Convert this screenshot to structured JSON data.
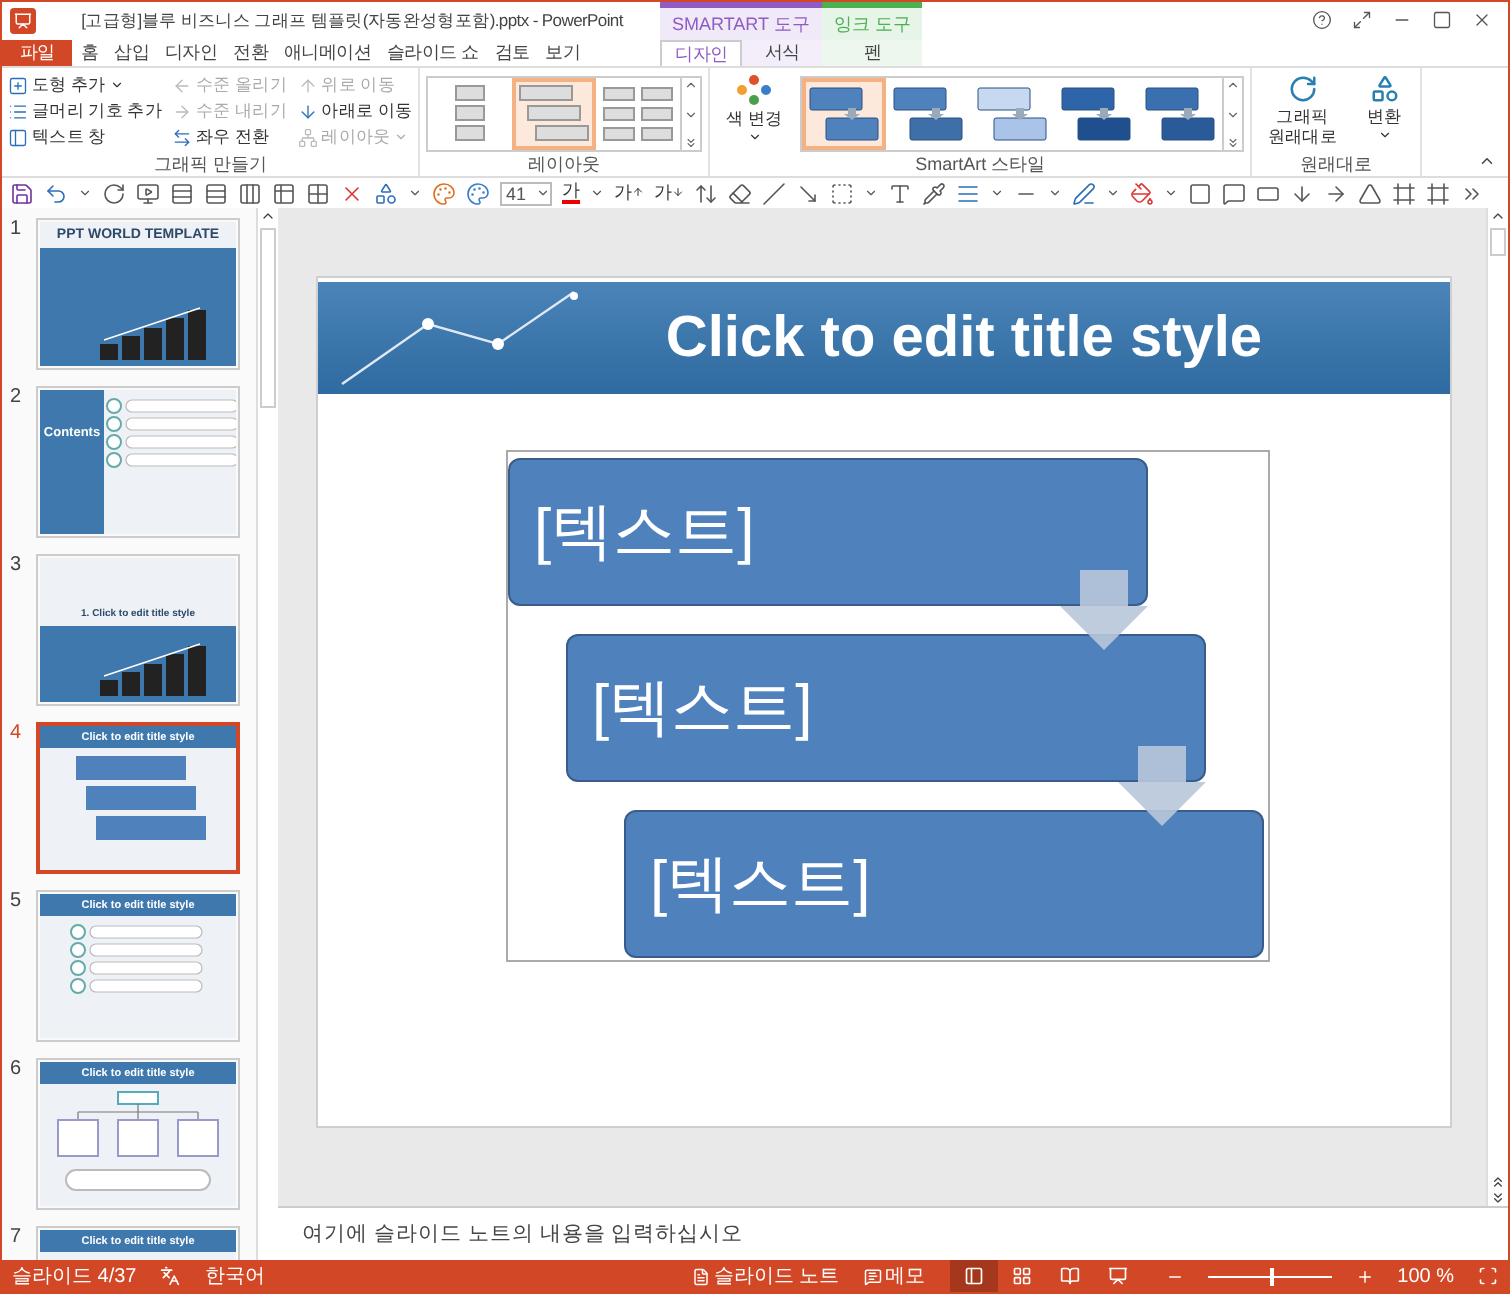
{
  "window": {
    "title": "[고급형]블루 비즈니스 그래프 템플릿(자동완성형포함).pptx - PowerPoint"
  },
  "tabs": [
    {
      "label": "파일",
      "kind": "file",
      "selected": false
    },
    {
      "label": "홈",
      "kind": "main",
      "selected": false
    },
    {
      "label": "삽입",
      "kind": "main",
      "selected": false
    },
    {
      "label": "디자인",
      "kind": "main",
      "selected": false
    },
    {
      "label": "전환",
      "kind": "main",
      "selected": false
    },
    {
      "label": "애니메이션",
      "kind": "main",
      "selected": false
    },
    {
      "label": "슬라이드 쇼",
      "kind": "main",
      "selected": false
    },
    {
      "label": "검토",
      "kind": "main",
      "selected": false
    },
    {
      "label": "보기",
      "kind": "main",
      "selected": false
    }
  ],
  "context_groups": [
    {
      "label": "SMARTART 도구",
      "color": "#8e5cc4",
      "tabs": [
        {
          "label": "디자인",
          "selected": true
        },
        {
          "label": "서식",
          "selected": false
        }
      ]
    },
    {
      "label": "잉크 도구",
      "color": "#4caf50",
      "tabs": [
        {
          "label": "펜",
          "selected": false
        }
      ]
    }
  ],
  "ribbon": {
    "groups": [
      {
        "kind": "commands",
        "label": "그래픽 만들기",
        "items": [
          {
            "label": "도형 추가",
            "disabled": false,
            "dropdown": true
          },
          {
            "label": "글머리 기호 추가",
            "disabled": false,
            "dropdown": false
          },
          {
            "label": "텍스트 창",
            "disabled": false,
            "dropdown": false
          },
          {
            "label": "수준 올리기",
            "disabled": true,
            "dropdown": false
          },
          {
            "label": "수준 내리기",
            "disabled": true,
            "dropdown": false
          },
          {
            "label": "좌우 전환",
            "disabled": false,
            "dropdown": false
          },
          {
            "label": "위로 이동",
            "disabled": true,
            "dropdown": false
          },
          {
            "label": "아래로 이동",
            "disabled": false,
            "dropdown": false
          },
          {
            "label": "레이아웃",
            "disabled": true,
            "dropdown": true
          }
        ]
      },
      {
        "kind": "gallery",
        "label": "레이아웃",
        "items": [
          {
            "selected": false
          },
          {
            "selected": true
          },
          {
            "selected": false
          }
        ]
      },
      {
        "kind": "styles",
        "label": "SmartArt 스타일",
        "color_button": "색 변경",
        "items": [
          {
            "selected": true
          },
          {
            "selected": false
          },
          {
            "selected": false
          },
          {
            "selected": false
          },
          {
            "selected": false
          }
        ]
      },
      {
        "kind": "large",
        "label": "원래대로",
        "items": [
          {
            "label": "그래픽 원래대로",
            "dropdown": false
          },
          {
            "label": "변환",
            "dropdown": true
          }
        ]
      }
    ]
  },
  "qat": {
    "font_size": "41",
    "font_color_glyph": "가",
    "grow_font_glyph": "가",
    "shrink_font_glyph": "가"
  },
  "slides": [
    {
      "number": "1",
      "kind": "cover",
      "title": "PPT WORLD TEMPLATE",
      "selected": false
    },
    {
      "number": "2",
      "kind": "contents",
      "title": "Contents",
      "selected": false
    },
    {
      "number": "3",
      "kind": "section",
      "title": "1. Click to edit title style",
      "selected": false
    },
    {
      "number": "4",
      "kind": "flow",
      "title": "Click to edit title style",
      "selected": true
    },
    {
      "number": "5",
      "kind": "list",
      "title": "Click to edit title style",
      "selected": false
    },
    {
      "number": "6",
      "kind": "org",
      "title": "Click to edit title style",
      "selected": false
    },
    {
      "number": "7",
      "kind": "title",
      "title": "Click to edit title style",
      "selected": false
    }
  ],
  "slide": {
    "title": "Click to edit title style",
    "smartart": [
      "[텍스트]",
      "[텍스트]",
      "[텍스트]"
    ]
  },
  "notes": {
    "placeholder": "여기에 슬라이드 노트의 내용을 입력하십시오"
  },
  "status_bar": {
    "slide": "슬라이드 4/37",
    "language": "한국어",
    "notes": "슬라이드 노트",
    "comments": "메모",
    "views": [
      {
        "selected": true
      },
      {
        "selected": false
      },
      {
        "selected": false
      },
      {
        "selected": false
      }
    ],
    "zoom": {
      "level": 0.5,
      "reading": "100 %"
    }
  }
}
